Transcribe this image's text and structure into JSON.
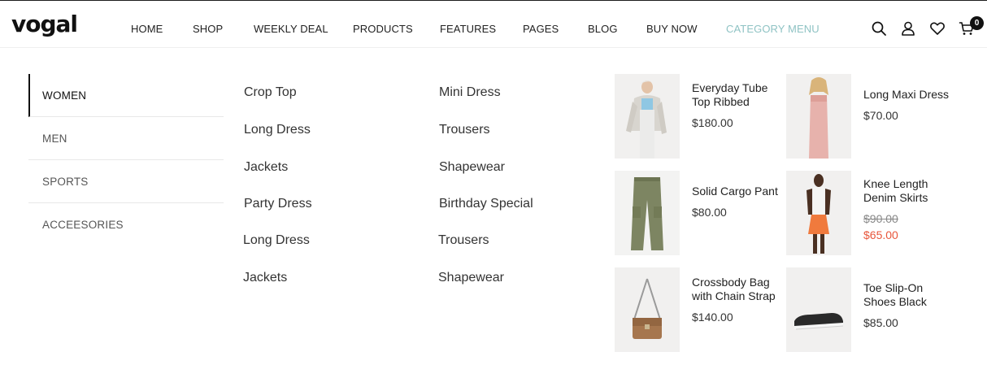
{
  "header": {
    "logo": "vogal",
    "nav": [
      "HOME",
      "SHOP",
      "WEEKLY DEAL",
      "PRODUCTS",
      "FEATURES",
      "PAGES",
      "BLOG",
      "BUY NOW",
      "CATEGORY MENU"
    ],
    "active_nav": "CATEGORY MENU",
    "accent_color": "#8fc3c4",
    "icons": [
      "search-icon",
      "user-icon",
      "heart-icon",
      "cart-icon"
    ],
    "cart_count": "0"
  },
  "menu": {
    "categories": [
      "WOMEN",
      "MEN",
      "SPORTS",
      "ACCEESORIES"
    ],
    "active_category": "WOMEN",
    "column1": [
      "Crop Top",
      "Long Dress",
      "Jackets",
      "Party Dress",
      "Long Dress",
      "Jackets"
    ],
    "column2": [
      "Mini Dress",
      "Trousers",
      "Shapewear",
      "Birthday Special",
      "Trousers",
      "Shapewear"
    ],
    "products": [
      {
        "name": "Everyday Tube Top Ribbed",
        "price": "$180.00"
      },
      {
        "name": "Long Maxi Dress",
        "price": "$70.00"
      },
      {
        "name": "Solid Cargo Pant",
        "price": "$80.00"
      },
      {
        "name": "Knee Length Denim Skirts",
        "old_price": "$90.00",
        "sale_price": "$65.00"
      },
      {
        "name": "Crossbody Bag with Chain Strap",
        "price": "$140.00"
      },
      {
        "name": "Toe Slip-On Shoes Black",
        "price": "$85.00"
      }
    ],
    "sale_color": "#e8563b"
  }
}
